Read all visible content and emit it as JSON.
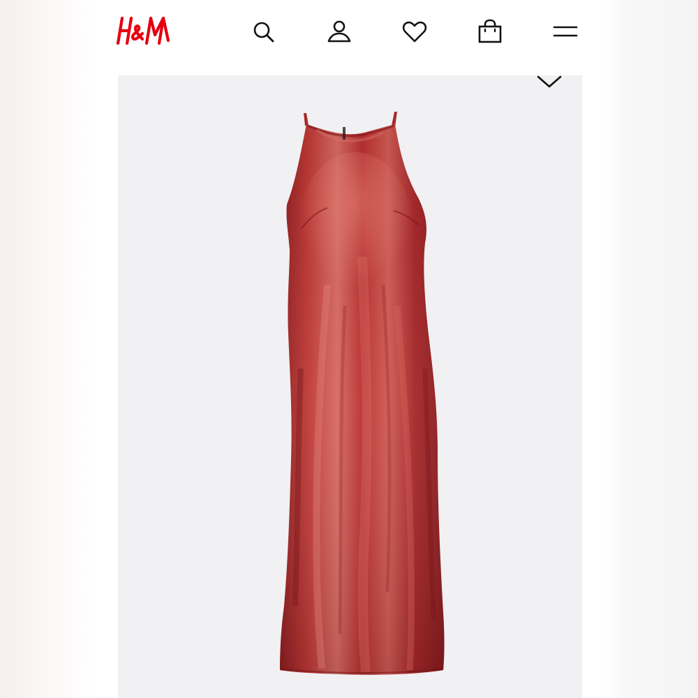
{
  "header": {
    "brand": "H&M",
    "brand_color": "#e50010",
    "icons": [
      "search-icon",
      "account-icon",
      "favorites-heart-icon",
      "shopping-bag-icon",
      "menu-hamburger-icon"
    ]
  },
  "product": {
    "image": "product-photo-red-satin-halter-maxi-dress",
    "dress_color": "#b42a2b",
    "background_color": "#f1f0f2",
    "collapse_icon": "chevron-down-icon"
  }
}
